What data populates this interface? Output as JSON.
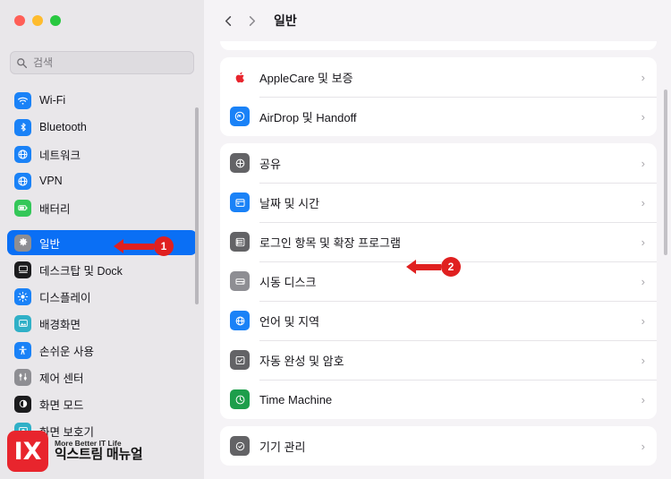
{
  "window": {
    "traffic_lights": [
      "close",
      "minimize",
      "zoom"
    ]
  },
  "sidebar": {
    "search": {
      "placeholder": "검색",
      "icon": "search-icon"
    },
    "items": [
      {
        "label": "Wi-Fi",
        "icon": "wifi-icon",
        "color": "#1a82f7",
        "glyph": "◗",
        "selected": false
      },
      {
        "label": "Bluetooth",
        "icon": "bluetooth-icon",
        "color": "#1a82f7",
        "glyph": "B",
        "selected": false
      },
      {
        "label": "네트워크",
        "icon": "network-icon",
        "color": "#1a82f7",
        "glyph": "◉",
        "selected": false
      },
      {
        "label": "VPN",
        "icon": "vpn-icon",
        "color": "#1a82f7",
        "glyph": "◉",
        "selected": false
      },
      {
        "label": "배터리",
        "icon": "battery-icon",
        "color": "#34c759",
        "glyph": "▭",
        "selected": false
      },
      {
        "label": "일반",
        "icon": "general-gear-icon",
        "color": "#8e8e93",
        "glyph": "⚙",
        "selected": true
      },
      {
        "label": "데스크탑 및 Dock",
        "icon": "desktop-dock-icon",
        "color": "#1a1a1a",
        "glyph": "▦",
        "selected": false
      },
      {
        "label": "디스플레이",
        "icon": "display-icon",
        "color": "#1a82f7",
        "glyph": "☀",
        "selected": false
      },
      {
        "label": "배경화면",
        "icon": "wallpaper-icon",
        "color": "#30b0c7",
        "glyph": "▧",
        "selected": false
      },
      {
        "label": "손쉬운 사용",
        "icon": "accessibility-icon",
        "color": "#1a82f7",
        "glyph": "☺",
        "selected": false
      },
      {
        "label": "제어 센터",
        "icon": "control-center-icon",
        "color": "#8e8e93",
        "glyph": "▤",
        "selected": false
      },
      {
        "label": "화면 모드",
        "icon": "screen-mode-icon",
        "color": "#1a1a1a",
        "glyph": "◐",
        "selected": false
      },
      {
        "label": "화면 보호기",
        "icon": "screensaver-icon",
        "color": "#30b0c7",
        "glyph": "▣",
        "selected": false
      }
    ]
  },
  "toolbar": {
    "back_label": "‹",
    "forward_label": "›",
    "title": "일반"
  },
  "main": {
    "groups": [
      {
        "rows": [
          {
            "label": "AppleCare 및 보증",
            "icon": "applecare-icon",
            "color": "#ffffff",
            "glyph": "",
            "chevron": "›"
          },
          {
            "label": "AirDrop 및 Handoff",
            "icon": "airdrop-icon",
            "color": "#1a82f7",
            "glyph": "◉",
            "chevron": "›"
          }
        ]
      },
      {
        "rows": [
          {
            "label": "공유",
            "icon": "sharing-icon",
            "color": "#636366",
            "glyph": "◉",
            "chevron": "›"
          },
          {
            "label": "날짜 및 시간",
            "icon": "date-time-icon",
            "color": "#1a82f7",
            "glyph": "▦",
            "chevron": "›"
          },
          {
            "label": "로그인 항목 및 확장 프로그램",
            "icon": "login-items-icon",
            "color": "#636366",
            "glyph": "▤",
            "chevron": "›"
          },
          {
            "label": "시동 디스크",
            "icon": "startup-disk-icon",
            "color": "#8e8e93",
            "glyph": "▭",
            "chevron": "›"
          },
          {
            "label": "언어 및 지역",
            "icon": "language-region-icon",
            "color": "#1a82f7",
            "glyph": "◉",
            "chevron": "›"
          },
          {
            "label": "자동 완성 및 암호",
            "icon": "autofill-passwords-icon",
            "color": "#636366",
            "glyph": "▣",
            "chevron": "›"
          },
          {
            "label": "Time Machine",
            "icon": "time-machine-icon",
            "color": "#1d9e4b",
            "glyph": "◴",
            "chevron": "›"
          }
        ]
      },
      {
        "rows": [
          {
            "label": "기기 관리",
            "icon": "device-management-icon",
            "color": "#636366",
            "glyph": "◉",
            "chevron": "›"
          }
        ]
      }
    ]
  },
  "annotations": [
    {
      "number": "1",
      "target": "sidebar-item-general"
    },
    {
      "number": "2",
      "target": "row-login-items"
    }
  ],
  "watermark": {
    "logo_text": "IX",
    "tagline": "More Better IT Life",
    "name": "익스트림 매뉴얼"
  }
}
